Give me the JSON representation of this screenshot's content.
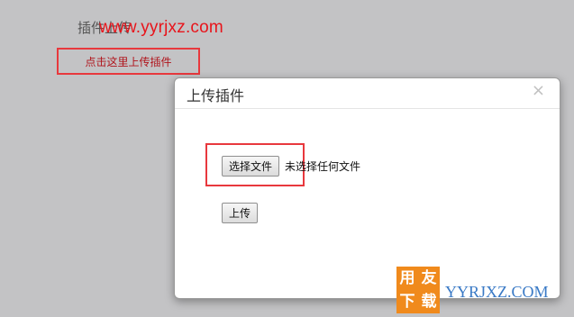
{
  "page": {
    "title": "插件上传",
    "upload_link": "点击这里上传插件"
  },
  "watermark": {
    "text": "www.yyrjxz.com",
    "color": "#e8141b"
  },
  "modal": {
    "title": "上传插件",
    "close_glyph": "×",
    "choose_file_label": "选择文件",
    "file_status": "未选择任何文件",
    "upload_label": "上传"
  },
  "badge": {
    "chars": [
      "用",
      "友",
      "下",
      "载"
    ],
    "brand_text": "YYRJXZ.COM",
    "color": "#f08a1c"
  },
  "highlight_color": "#e8383d"
}
